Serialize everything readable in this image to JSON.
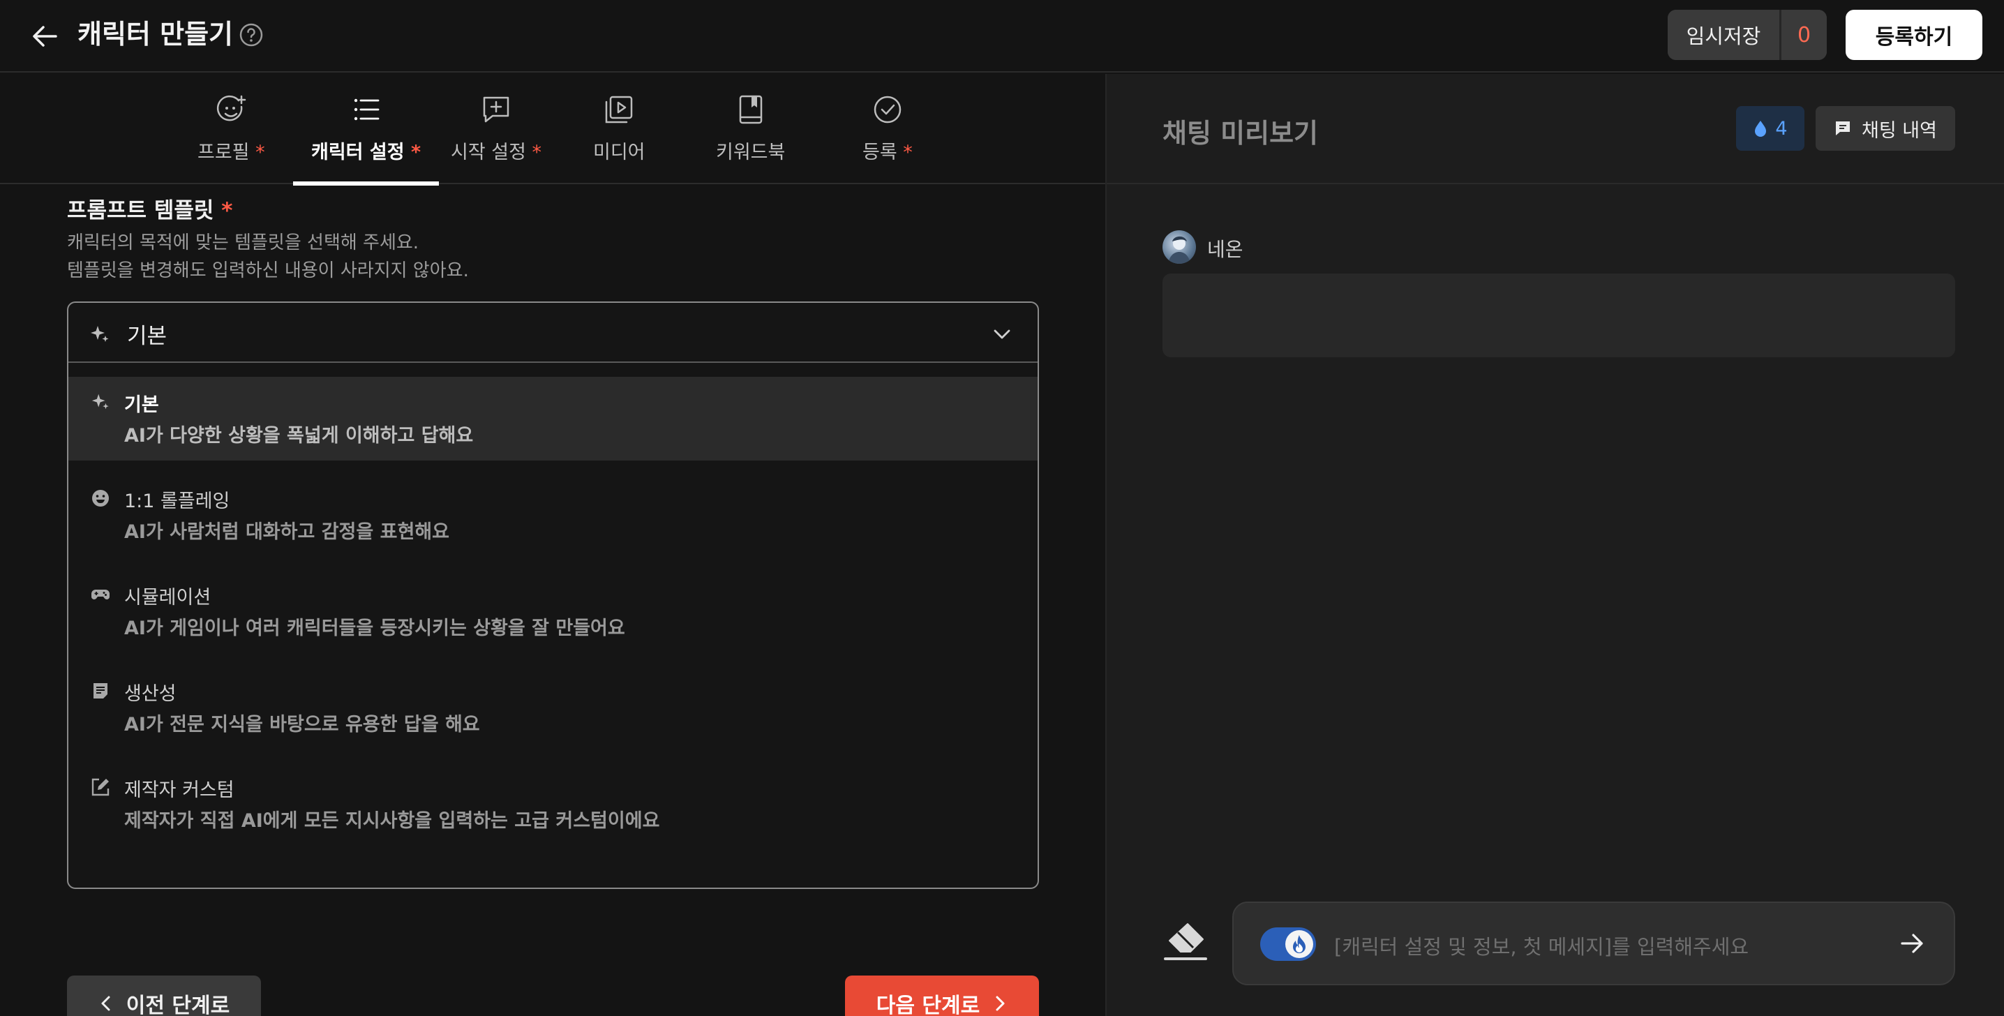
{
  "header": {
    "title": "캐릭터 만들기",
    "draft_label": "임시저장",
    "draft_count": "0",
    "register_label": "등록하기"
  },
  "tabs": [
    {
      "label": "프로필",
      "required": "*",
      "icon": "smiley-plus-icon"
    },
    {
      "label": "캐릭터 설정",
      "required": "*",
      "icon": "list-icon",
      "active": true
    },
    {
      "label": "시작 설정",
      "required": "*",
      "icon": "chat-plus-icon"
    },
    {
      "label": "미디어",
      "required": "",
      "icon": "media-play-icon"
    },
    {
      "label": "키워드북",
      "required": "",
      "icon": "book-icon"
    },
    {
      "label": "등록",
      "required": "*",
      "icon": "check-circle-icon"
    }
  ],
  "section": {
    "title": "프롬프트 템플릿",
    "required": "*",
    "desc_line1": "캐릭터의 목적에 맞는 템플릿을 선택해 주세요.",
    "desc_line2": "템플릿을 변경해도 입력하신 내용이 사라지지 않아요."
  },
  "select": {
    "value": "기본",
    "options": [
      {
        "title": "기본",
        "desc": "AI가 다양한 상황을 폭넓게 이해하고 답해요",
        "icon": "sparkle-icon",
        "selected": true
      },
      {
        "title": "1:1 롤플레잉",
        "desc": "AI가 사람처럼 대화하고 감정을 표현해요",
        "icon": "smile-face-icon"
      },
      {
        "title": "시뮬레이션",
        "desc": "AI가 게임이나 여러 캐릭터들을 등장시키는 상황을 잘 만들어요",
        "icon": "gamepad-icon"
      },
      {
        "title": "생산성",
        "desc": "AI가 전문 지식을 바탕으로 유용한 답을 해요",
        "icon": "document-icon"
      },
      {
        "title": "제작자 커스텀",
        "desc": "제작자가 직접 AI에게 모든 지시사항을 입력하는 고급 커스텀이에요",
        "icon": "edit-square-icon"
      }
    ]
  },
  "nav": {
    "prev_label": "이전 단계로",
    "next_label": "다음 단계로"
  },
  "preview": {
    "title": "채팅 미리보기",
    "drop_count": "4",
    "history_label": "채팅 내역",
    "character_name": "네온",
    "input_placeholder": "[캐릭터 설정 및 정보, 첫 메세지]를 입력해주세요"
  },
  "colors": {
    "accent": "#e84a35",
    "draft_count": "#ff6a52",
    "drop_blue": "#5aa2ff",
    "toggle_blue": "#2b5fb8"
  }
}
